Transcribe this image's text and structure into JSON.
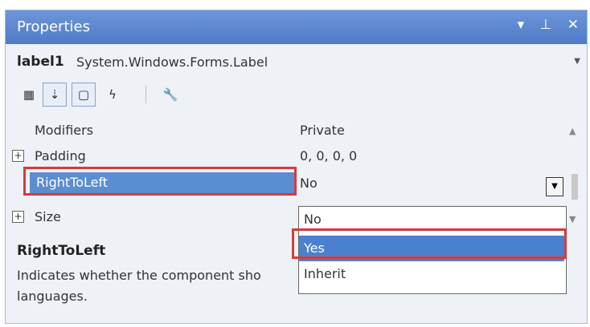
{
  "window": {
    "title": "Properties",
    "controls": [
      "▾",
      "⊥",
      "✕"
    ]
  },
  "object": {
    "name": "label1",
    "type": "System.Windows.Forms.Label"
  },
  "toolbar": {
    "buttons": [
      "categorized-icon",
      "alphabetical-icon",
      "properties-icon",
      "events-icon",
      "property-pages-icon"
    ]
  },
  "grid": {
    "rows": [
      {
        "name": "Modifiers",
        "value": "Private",
        "expandable": false
      },
      {
        "name": "Padding",
        "value": "0, 0, 0, 0",
        "expandable": true
      },
      {
        "name": "RightToLeft",
        "value": "No",
        "expandable": false,
        "selected": true
      },
      {
        "name": "Size",
        "value": "",
        "expandable": true
      }
    ]
  },
  "dropdown": {
    "options": [
      "No",
      "Yes",
      "Inherit"
    ],
    "highlighted": "Yes"
  },
  "description": {
    "title": "RightToLeft",
    "text": "Indicates whether the component sho",
    "text2": "languages."
  },
  "colors": {
    "selection": "#5b8dd1",
    "highlight_box": "#d43b3b",
    "titlebar": "#5a86cf"
  }
}
